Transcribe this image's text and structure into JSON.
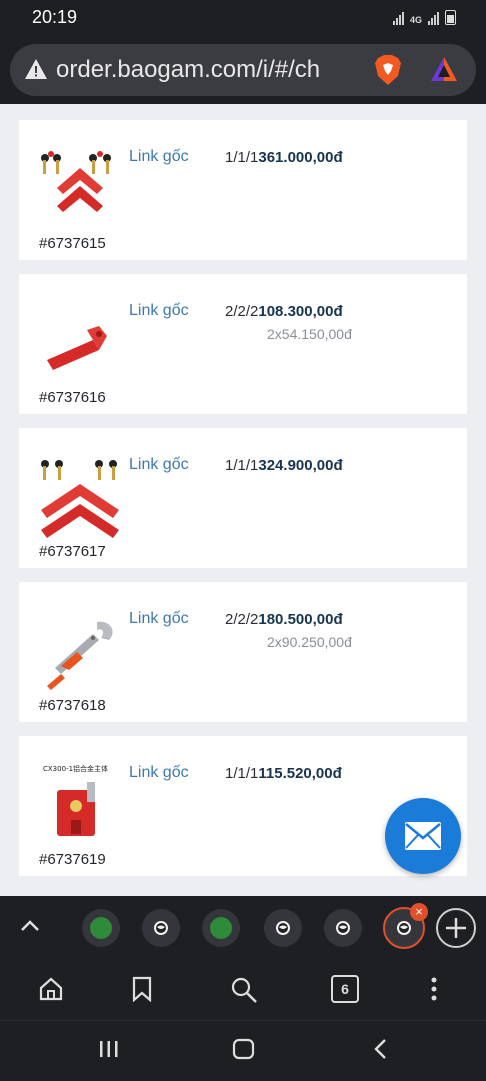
{
  "status_bar": {
    "time": "20:19",
    "network": "4G"
  },
  "browser": {
    "url": "order.baogam.com/i/#/ch"
  },
  "items": [
    {
      "id": "#6737615",
      "link_label": "Link gốc",
      "qty_prefix": "1/1/1",
      "total": "361.000,00đ",
      "unit_price": ""
    },
    {
      "id": "#6737616",
      "link_label": "Link gốc",
      "qty_prefix": "2/2/2",
      "total": "108.300,00đ",
      "unit_price": "2x54.150,00đ"
    },
    {
      "id": "#6737617",
      "link_label": "Link gốc",
      "qty_prefix": "1/1/1",
      "total": "324.900,00đ",
      "unit_price": ""
    },
    {
      "id": "#6737618",
      "link_label": "Link gốc",
      "qty_prefix": "2/2/2",
      "total": "180.500,00đ",
      "unit_price": "2x90.250,00đ"
    },
    {
      "id": "#6737619",
      "link_label": "Link gốc",
      "qty_prefix": "1/1/1",
      "total": "115.520,00đ",
      "unit_price": "",
      "image_caption": "CX300-1铝合金主体"
    }
  ],
  "tab_strip": {
    "tab_count": "6"
  },
  "colors": {
    "link": "#3d79b0",
    "price": "#163450",
    "fab": "#1a7bd9",
    "active_tab": "#e0502a"
  }
}
